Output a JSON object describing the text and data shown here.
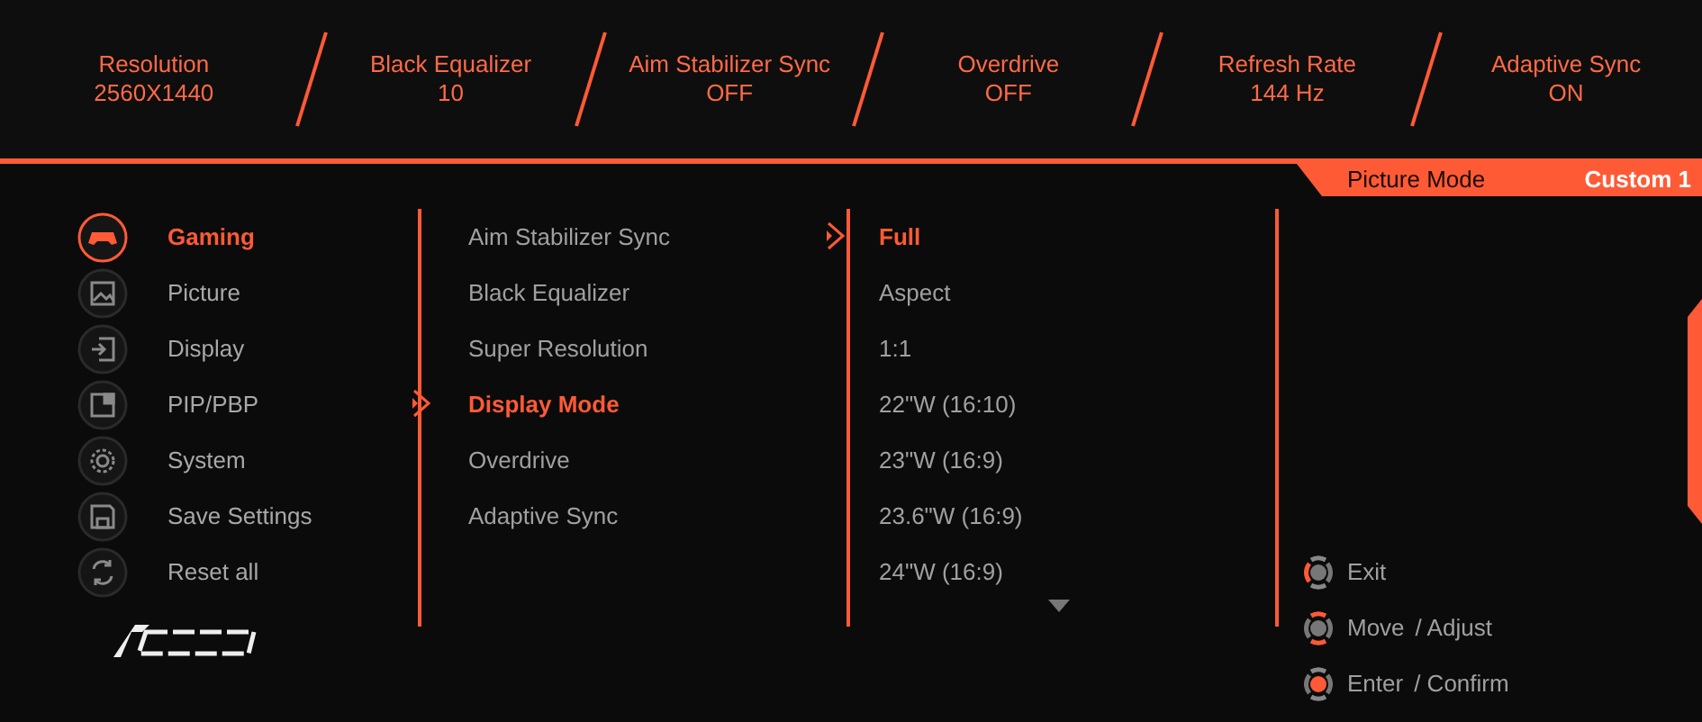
{
  "status_items": [
    {
      "label": "Resolution",
      "value": "2560X1440"
    },
    {
      "label": "Black Equalizer",
      "value": "10"
    },
    {
      "label": "Aim Stabilizer Sync",
      "value": "OFF"
    },
    {
      "label": "Overdrive",
      "value": "OFF"
    },
    {
      "label": "Refresh Rate",
      "value": "144 Hz"
    },
    {
      "label": "Adaptive Sync",
      "value": "ON"
    }
  ],
  "picture_mode": {
    "label": "Picture Mode",
    "value": "Custom 1"
  },
  "menu": [
    {
      "label": "Gaming",
      "selected": true
    },
    {
      "label": "Picture",
      "selected": false
    },
    {
      "label": "Display",
      "selected": false
    },
    {
      "label": "PIP/PBP",
      "selected": false
    },
    {
      "label": "System",
      "selected": false
    },
    {
      "label": "Save Settings",
      "selected": false
    },
    {
      "label": "Reset all",
      "selected": false
    }
  ],
  "submenu": [
    {
      "label": "Aim Stabilizer Sync",
      "selected": false
    },
    {
      "label": "Black Equalizer",
      "selected": false
    },
    {
      "label": "Super Resolution",
      "selected": false
    },
    {
      "label": "Display Mode",
      "selected": true
    },
    {
      "label": "Overdrive",
      "selected": false
    },
    {
      "label": "Adaptive Sync",
      "selected": false
    }
  ],
  "options": [
    {
      "label": "Full",
      "selected": true
    },
    {
      "label": "Aspect",
      "selected": false
    },
    {
      "label": "1:1",
      "selected": false
    },
    {
      "label": "22\"W (16:10)",
      "selected": false
    },
    {
      "label": "23\"W (16:9)",
      "selected": false
    },
    {
      "label": "23.6\"W (16:9)",
      "selected": false
    },
    {
      "label": "24\"W (16:9)",
      "selected": false
    }
  ],
  "hints": [
    {
      "kind": "left",
      "action": "Exit"
    },
    {
      "kind": "vertical",
      "action": "Move",
      "secondary": "/ Adjust"
    },
    {
      "kind": "center",
      "action": "Enter",
      "secondary": "/ Confirm"
    }
  ]
}
